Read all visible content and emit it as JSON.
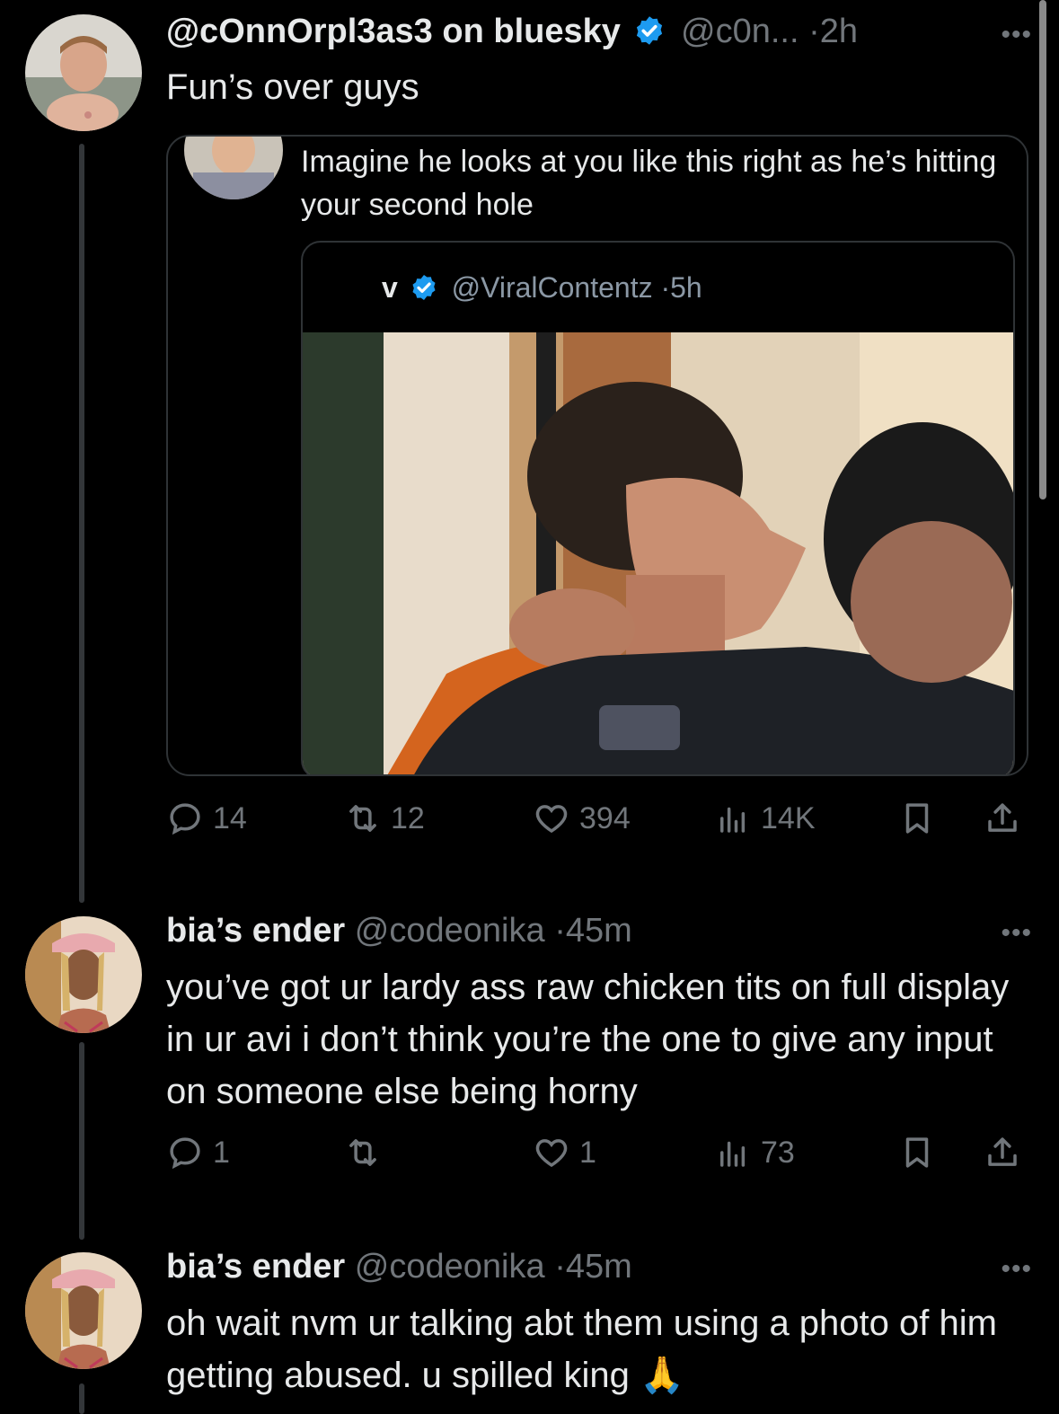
{
  "tweet_main": {
    "display_name": "@cOnnOrpl3as3 on bluesky",
    "handle": "@c0n...",
    "dot": "·",
    "time": "2h",
    "text": "Fun’s over guys",
    "more": "•••",
    "quote": {
      "text": "Imagine he looks at you like this right as he’s hitting your second hole",
      "inner": {
        "name": "v",
        "handle": "@ViralContentz",
        "dot": "·",
        "time": "5h"
      }
    },
    "stats": {
      "replies": "14",
      "reposts": "12",
      "likes": "394",
      "views": "14K"
    }
  },
  "reply_1": {
    "display_name": "bia’s ender",
    "handle": "@codeonika",
    "dot": "·",
    "time": "45m",
    "more": "•••",
    "text": "you’ve got ur lardy ass raw chicken tits on full display in ur avi i don’t think you’re the one to give any input on someone else being horny",
    "stats": {
      "replies": "1",
      "reposts": "",
      "likes": "1",
      "views": "73"
    }
  },
  "reply_2": {
    "display_name": "bia’s ender",
    "handle": "@codeonika",
    "dot": "·",
    "time": "45m",
    "more": "•••",
    "text": "oh wait nvm ur talking abt them using a photo of him getting abused. u spilled king 🙏"
  },
  "icons": {
    "reply": "reply-icon",
    "repost": "repost-icon",
    "like": "heart-icon",
    "views": "views-icon",
    "bookmark": "bookmark-icon",
    "share": "share-icon",
    "verified": "verified-badge-icon"
  },
  "colors": {
    "background": "#000000",
    "text": "#e7e9ea",
    "muted": "#71767b",
    "verified": "#1d9bf0",
    "border": "#2f3336"
  }
}
